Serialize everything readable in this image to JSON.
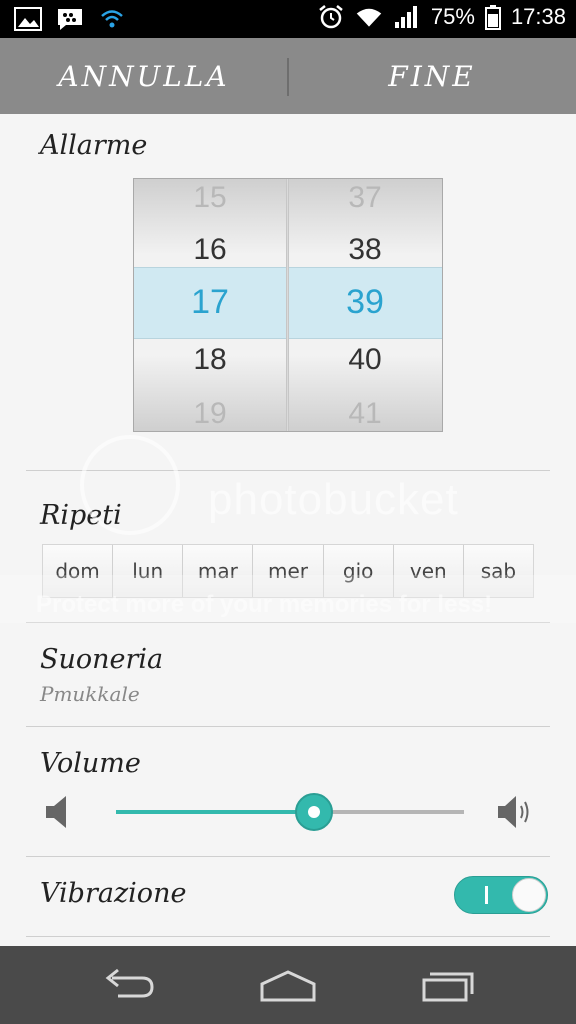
{
  "status_bar": {
    "battery": "75%",
    "time": "17:38",
    "icons": [
      "gallery-icon",
      "bbm-icon",
      "wifi-icon",
      "alarm-icon",
      "wifi-signal-icon",
      "cell-signal-icon",
      "battery-icon"
    ]
  },
  "action_bar": {
    "cancel_label": "ANNULLA",
    "done_label": "FINE"
  },
  "alarm": {
    "title": "Allarme",
    "hours": [
      "15",
      "16",
      "17",
      "18",
      "19"
    ],
    "minutes": [
      "37",
      "38",
      "39",
      "40",
      "41"
    ],
    "selected_hour": "17",
    "selected_minute": "39"
  },
  "repeat": {
    "title": "Ripeti",
    "days": [
      "dom",
      "lun",
      "mar",
      "mer",
      "gio",
      "ven",
      "sab"
    ]
  },
  "ringtone": {
    "title": "Suoneria",
    "value": "Pmukkale"
  },
  "volume": {
    "title": "Volume",
    "level": 0.57,
    "accent": "#33b9ad"
  },
  "vibration": {
    "title": "Vibrazione",
    "enabled": true
  },
  "watermark": {
    "brand": "photobucket",
    "tagline": "Protect more of your memories for less!"
  },
  "nav": [
    "back-icon",
    "home-icon",
    "recent-apps-icon"
  ]
}
